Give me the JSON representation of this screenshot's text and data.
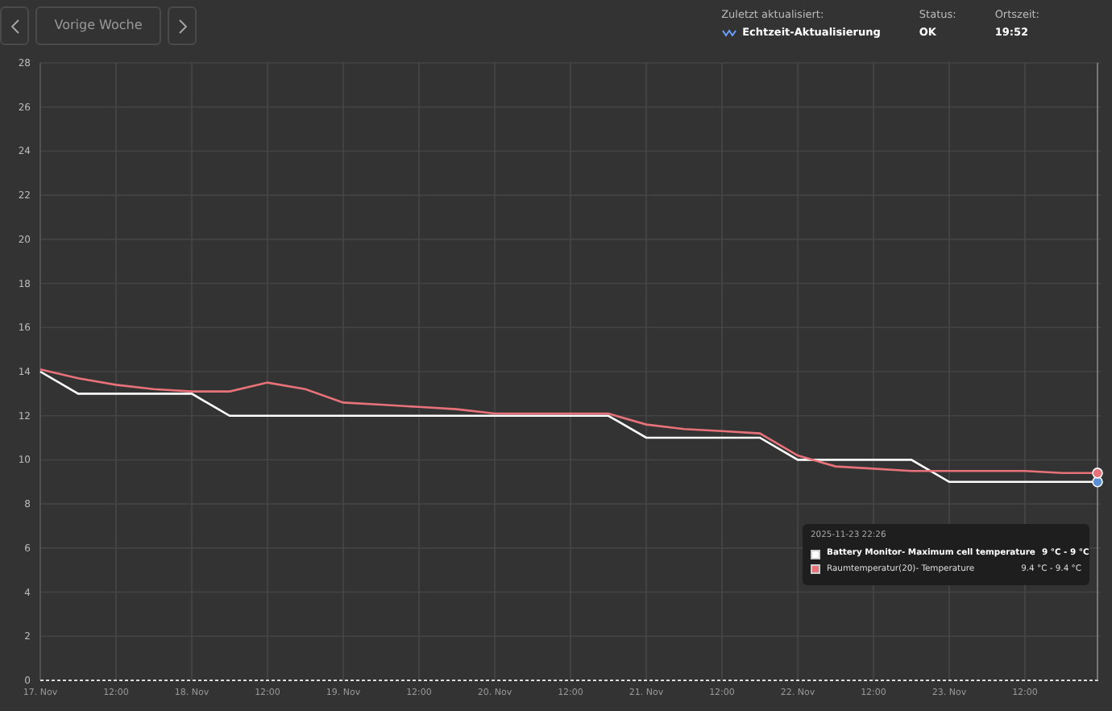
{
  "toolbar": {
    "prev_label": "Vorige Woche"
  },
  "status": [
    {
      "label": "Zuletzt aktualisiert:",
      "value": "Echtzeit-Aktualisierung",
      "kind": "live"
    },
    {
      "label": "Status:",
      "value": "OK",
      "kind": "plain"
    },
    {
      "label": "Ortszeit:",
      "value": "19:52",
      "kind": "plain"
    }
  ],
  "chart": {
    "chart_data": {
      "type": "line",
      "grid": true,
      "ylim": [
        0,
        28
      ],
      "yticks": [
        0,
        2,
        4,
        6,
        8,
        10,
        12,
        14,
        16,
        18,
        20,
        22,
        24,
        26,
        28
      ],
      "categories": [
        "17. Nov",
        null,
        "12:00",
        null,
        "18. Nov",
        null,
        "12:00",
        null,
        "19. Nov",
        null,
        "12:00",
        null,
        "20. Nov",
        null,
        "12:00",
        null,
        "21. Nov",
        null,
        "12:00",
        null,
        "22. Nov",
        null,
        "12:00",
        null,
        "23. Nov",
        null,
        "12:00",
        null,
        null
      ],
      "series": [
        {
          "name": "Battery Monitor- Maximum cell temperature",
          "color": "#ffffff",
          "values": [
            14,
            13,
            13,
            13,
            13,
            12,
            12,
            12,
            12,
            12,
            12,
            12,
            12,
            12,
            12,
            12,
            11,
            11,
            11,
            11,
            10,
            10,
            10,
            10,
            9,
            9,
            9,
            9,
            9
          ]
        },
        {
          "name": "Raumtemperatur(20)- Temperature",
          "color": "#e8727a",
          "values": [
            14.1,
            13.7,
            13.4,
            13.2,
            13.1,
            13.1,
            13.5,
            13.2,
            12.6,
            12.5,
            12.4,
            12.3,
            12.1,
            12.1,
            12.1,
            12.1,
            11.6,
            11.4,
            11.3,
            11.2,
            10.2,
            9.7,
            9.6,
            9.5,
            9.5,
            9.5,
            9.5,
            9.4,
            9.4
          ]
        }
      ]
    },
    "tooltip": {
      "time": "2025-11-23 22:26",
      "rows": [
        {
          "range": "9 °C - 9 °C",
          "bold": true
        },
        {
          "range": "9.4 °C - 9.4 °C",
          "bold": false
        }
      ]
    }
  }
}
